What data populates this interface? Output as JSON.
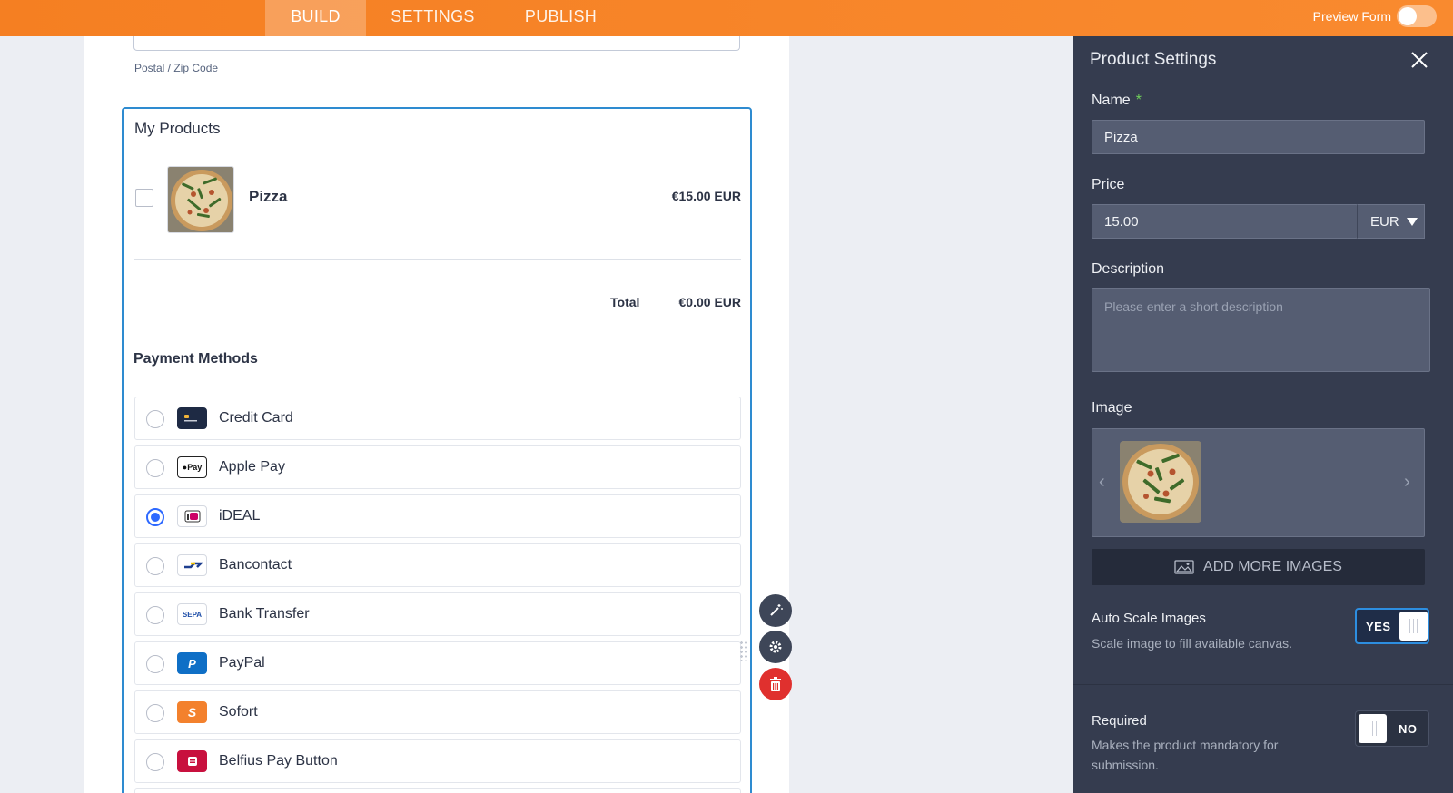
{
  "topbar": {
    "tabs": [
      {
        "label": "BUILD",
        "active": true
      },
      {
        "label": "SETTINGS",
        "active": false
      },
      {
        "label": "PUBLISH",
        "active": false
      }
    ],
    "preview_label": "Preview Form",
    "preview_on": false
  },
  "form": {
    "postal_label": "Postal / Zip Code",
    "products_title": "My Products",
    "product": {
      "name": "Pizza",
      "price": "€15.00 EUR",
      "checked": false
    },
    "total_label": "Total",
    "total_value": "€0.00 EUR",
    "payment_title": "Payment Methods",
    "payment_methods": [
      {
        "label": "Credit Card",
        "icon": "credit-card-icon",
        "selected": false
      },
      {
        "label": "Apple Pay",
        "icon": "apple-pay-icon",
        "selected": false
      },
      {
        "label": "iDEAL",
        "icon": "ideal-icon",
        "selected": true
      },
      {
        "label": "Bancontact",
        "icon": "bancontact-icon",
        "selected": false
      },
      {
        "label": "Bank Transfer",
        "icon": "sepa-icon",
        "selected": false
      },
      {
        "label": "PayPal",
        "icon": "paypal-icon",
        "selected": false
      },
      {
        "label": "Sofort",
        "icon": "sofort-icon",
        "selected": false
      },
      {
        "label": "Belfius Pay Button",
        "icon": "belfius-icon",
        "selected": false
      }
    ]
  },
  "panel": {
    "title": "Product Settings",
    "name_label": "Name",
    "name_value": "Pizza",
    "price_label": "Price",
    "price_value": "15.00",
    "currency": "EUR",
    "description_label": "Description",
    "description_placeholder": "Please enter a short description",
    "image_label": "Image",
    "add_images_label": "ADD MORE IMAGES",
    "auto_scale_label": "Auto Scale Images",
    "auto_scale_desc": "Scale image to fill available canvas.",
    "auto_scale_value": "YES",
    "required_label": "Required",
    "required_desc": "Makes the product mandatory for submission.",
    "required_value": "NO"
  },
  "colors": {
    "topbar": "#f98a2f",
    "accent": "#2e8bd0",
    "panel_bg": "#353c4f",
    "delete": "#e0302e"
  }
}
